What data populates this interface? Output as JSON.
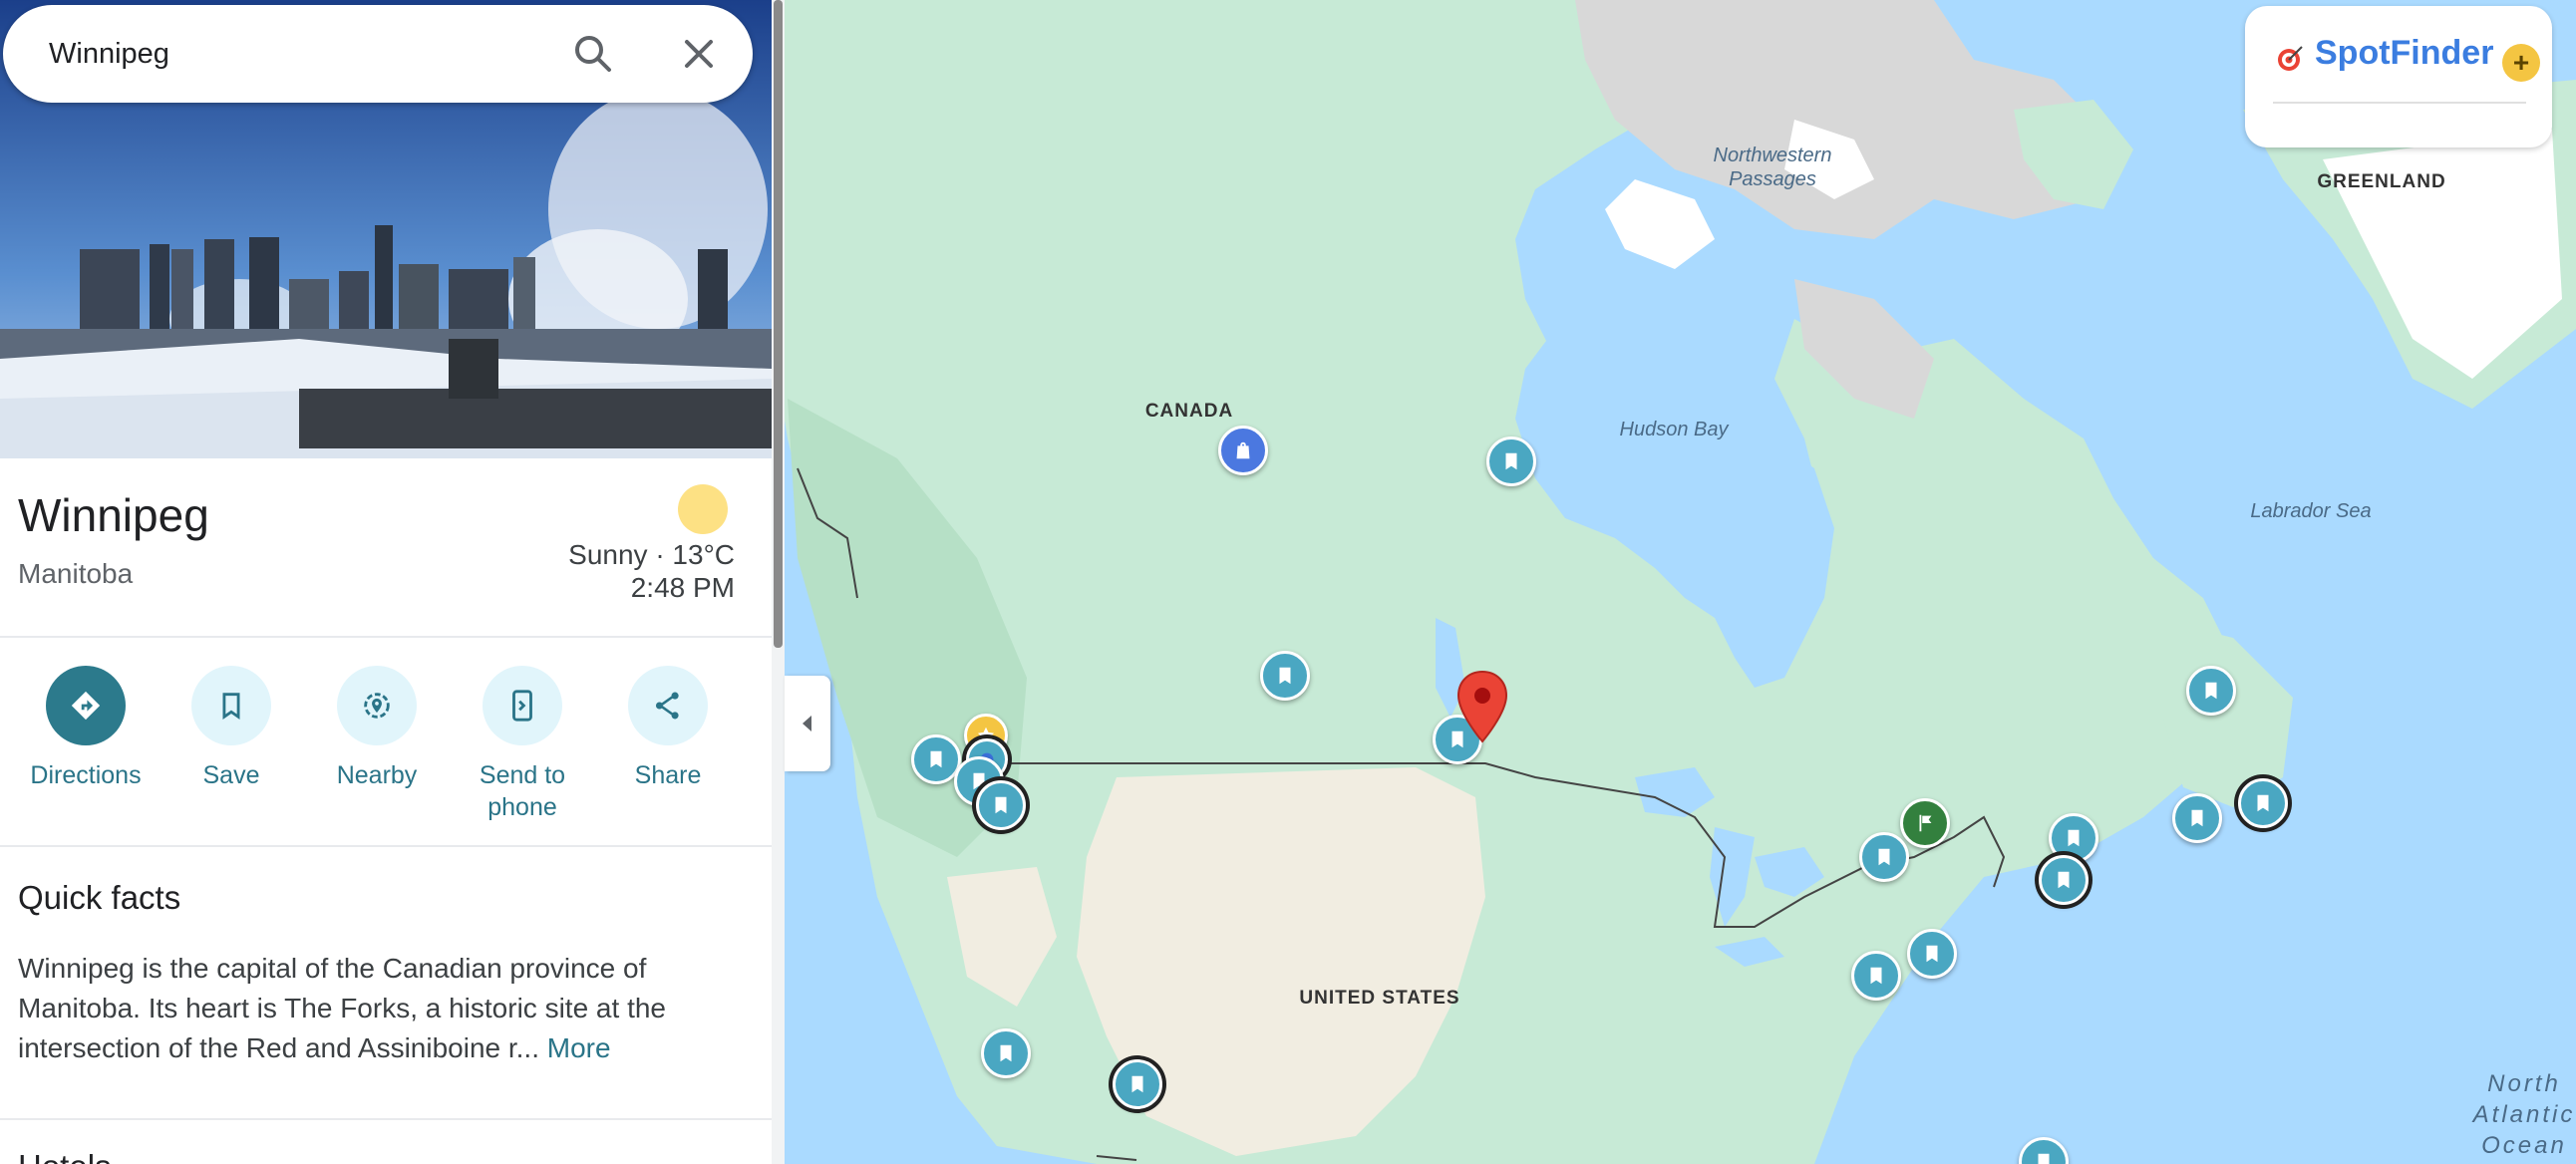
{
  "search": {
    "value": "Winnipeg",
    "search_icon": "search-icon",
    "close_icon": "close-icon"
  },
  "place": {
    "title": "Winnipeg",
    "region": "Manitoba",
    "weather": {
      "condition": "Sunny · 13°C",
      "time": "2:48 PM",
      "icon": "sun-icon"
    }
  },
  "actions": [
    {
      "label": "Directions",
      "icon": "directions-icon"
    },
    {
      "label": "Save",
      "icon": "bookmark-icon"
    },
    {
      "label": "Nearby",
      "icon": "nearby-icon"
    },
    {
      "label": "Send to phone",
      "icon": "send-to-phone-icon"
    },
    {
      "label": "Share",
      "icon": "share-icon"
    }
  ],
  "quick_facts": {
    "heading": "Quick facts",
    "text": "Winnipeg is the capital of the Canadian province of Manitoba. Its heart is The Forks, a historic site at the intersection of the Red and Assiniboine r...",
    "more": "More"
  },
  "hotels": {
    "heading": "Hotels"
  },
  "brand": {
    "name": "SpotFinder",
    "add": "+"
  },
  "map": {
    "labels": {
      "canada": "CANADA",
      "united_states": "UNITED STATES",
      "greenland": "GREENLAND",
      "northwestern_passages": "Northwestern Passages",
      "hudson_bay": "Hudson Bay",
      "labrador_sea": "Labrador Sea",
      "north_atlantic_ocean": "North Atlantic Ocean"
    }
  },
  "colors": {
    "water": "#aadaff",
    "land": "#c7ead6",
    "ice": "#d8d8d8",
    "snow": "#ffffff",
    "plains": "#f1ede1",
    "saved_pin": "#4aa7c2",
    "accent": "#2a7488",
    "red_marker": "#ea4335",
    "brand": "#3b7de0"
  }
}
